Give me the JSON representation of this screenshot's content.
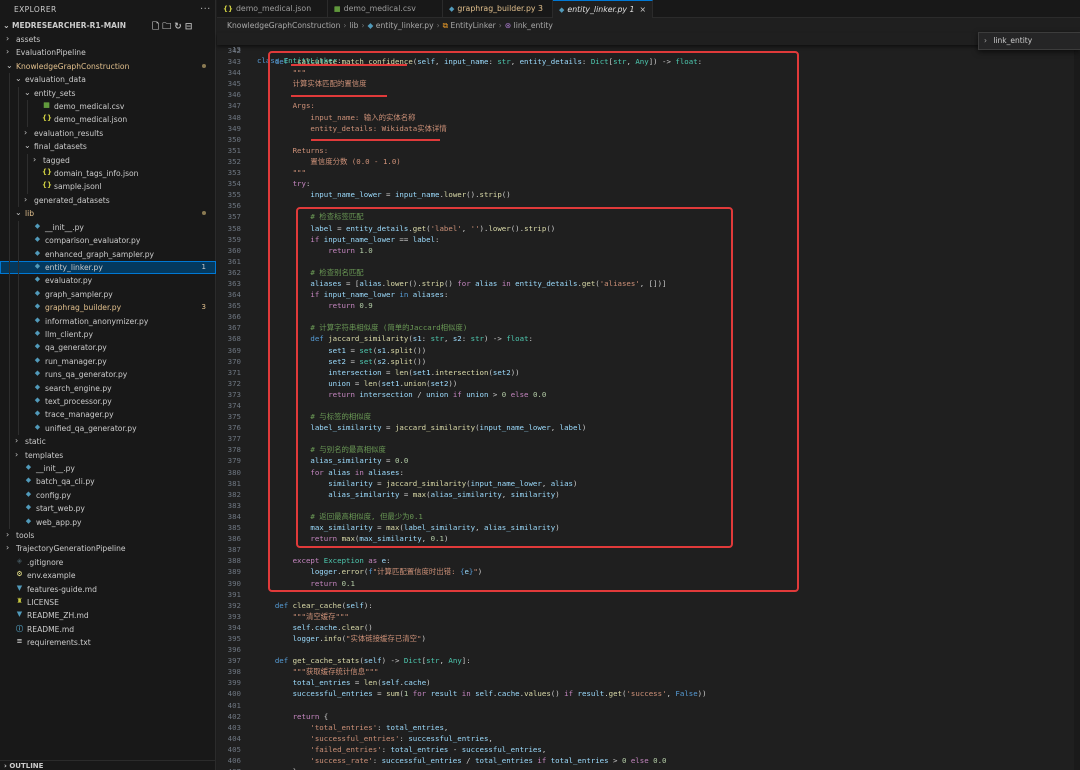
{
  "sidebar": {
    "title": "EXPLORER",
    "more": "···",
    "root_label": "MEDRESEARCHER-R1-MAIN",
    "tree": [
      {
        "depth": 0,
        "kind": "folder",
        "open": false,
        "label": "assets"
      },
      {
        "depth": 0,
        "kind": "folder",
        "open": false,
        "label": "EvaluationPipeline"
      },
      {
        "depth": 0,
        "kind": "folder",
        "open": true,
        "label": "KnowledgeGraphConstruction",
        "modified": true,
        "dot": true
      },
      {
        "depth": 1,
        "kind": "folder",
        "open": true,
        "label": "evaluation_data"
      },
      {
        "depth": 2,
        "kind": "folder",
        "open": true,
        "label": "entity_sets"
      },
      {
        "depth": 3,
        "kind": "csv",
        "label": "demo_medical.csv"
      },
      {
        "depth": 3,
        "kind": "json",
        "label": "demo_medical.json"
      },
      {
        "depth": 2,
        "kind": "folder",
        "open": false,
        "label": "evaluation_results"
      },
      {
        "depth": 2,
        "kind": "folder",
        "open": true,
        "label": "final_datasets"
      },
      {
        "depth": 3,
        "kind": "folder",
        "open": false,
        "label": "tagged"
      },
      {
        "depth": 3,
        "kind": "json",
        "label": "domain_tags_info.json"
      },
      {
        "depth": 3,
        "kind": "json",
        "label": "sample.jsonl"
      },
      {
        "depth": 2,
        "kind": "folder",
        "open": false,
        "label": "generated_datasets"
      },
      {
        "depth": 1,
        "kind": "folder",
        "open": true,
        "label": "lib",
        "modified": true,
        "dot": true
      },
      {
        "depth": 2,
        "kind": "py",
        "label": "__init__.py"
      },
      {
        "depth": 2,
        "kind": "py",
        "label": "comparison_evaluator.py"
      },
      {
        "depth": 2,
        "kind": "py",
        "label": "enhanced_graph_sampler.py"
      },
      {
        "depth": 2,
        "kind": "py",
        "label": "entity_linker.py",
        "active": true,
        "badge": "1"
      },
      {
        "depth": 2,
        "kind": "py",
        "label": "evaluator.py"
      },
      {
        "depth": 2,
        "kind": "py",
        "label": "graph_sampler.py"
      },
      {
        "depth": 2,
        "kind": "py",
        "label": "graphrag_builder.py",
        "modified": true,
        "badge": "3"
      },
      {
        "depth": 2,
        "kind": "py",
        "label": "information_anonymizer.py"
      },
      {
        "depth": 2,
        "kind": "py",
        "label": "llm_client.py"
      },
      {
        "depth": 2,
        "kind": "py",
        "label": "qa_generator.py"
      },
      {
        "depth": 2,
        "kind": "py",
        "label": "run_manager.py"
      },
      {
        "depth": 2,
        "kind": "py",
        "label": "runs_qa_generator.py"
      },
      {
        "depth": 2,
        "kind": "py",
        "label": "search_engine.py"
      },
      {
        "depth": 2,
        "kind": "py",
        "label": "text_processor.py"
      },
      {
        "depth": 2,
        "kind": "py",
        "label": "trace_manager.py"
      },
      {
        "depth": 2,
        "kind": "py",
        "label": "unified_qa_generator.py"
      },
      {
        "depth": 1,
        "kind": "folder",
        "open": false,
        "label": "static"
      },
      {
        "depth": 1,
        "kind": "folder",
        "open": false,
        "label": "templates"
      },
      {
        "depth": 1,
        "kind": "py",
        "label": "__init__.py"
      },
      {
        "depth": 1,
        "kind": "py",
        "label": "batch_qa_cli.py"
      },
      {
        "depth": 1,
        "kind": "py",
        "label": "config.py"
      },
      {
        "depth": 1,
        "kind": "py",
        "label": "start_web.py"
      },
      {
        "depth": 1,
        "kind": "py",
        "label": "web_app.py"
      },
      {
        "depth": 0,
        "kind": "folder",
        "open": false,
        "label": "tools"
      },
      {
        "depth": 0,
        "kind": "folder",
        "open": false,
        "label": "TrajectoryGenerationPipeline"
      },
      {
        "depth": 0,
        "kind": "git",
        "label": ".gitignore"
      },
      {
        "depth": 0,
        "kind": "env",
        "label": "env.example"
      },
      {
        "depth": 0,
        "kind": "md",
        "label": "features-guide.md"
      },
      {
        "depth": 0,
        "kind": "license",
        "label": "LICENSE"
      },
      {
        "depth": 0,
        "kind": "md",
        "label": "README_ZH.md"
      },
      {
        "depth": 0,
        "kind": "info",
        "label": "README.md"
      },
      {
        "depth": 0,
        "kind": "txt",
        "label": "requirements.txt"
      }
    ],
    "outline_label": "OUTLINE"
  },
  "tabs": [
    {
      "icon": "{}",
      "label": "demo_medical.json",
      "color": "#cbcb41"
    },
    {
      "icon": "▦",
      "label": "demo_medical.csv",
      "color": "#89e051"
    },
    {
      "icon": "◆",
      "label": "graphrag_builder.py 3",
      "color": "#519aba",
      "modified": true
    },
    {
      "icon": "◆",
      "label": "entity_linker.py 1",
      "color": "#519aba",
      "active": true,
      "close": "×"
    }
  ],
  "breadcrumb": [
    "KnowledgeGraphConstruction",
    "lib",
    "entity_linker.py",
    "EntityLinker",
    "link_entity"
  ],
  "find_widget": {
    "label": "link_entity"
  },
  "sticky": {
    "ln": "13",
    "code": "class EntityLinker:"
  },
  "code_lines": [
    {
      "n": "342",
      "h": ""
    },
    {
      "n": "343",
      "h": "    <span class='kw'>def</span> <span class='fn'>_calculate_match_confidence</span>(<span class='va'>self</span>, <span class='va'>input_name</span>: <span class='ty'>str</span>, <span class='va'>entity_details</span>: <span class='ty'>Dict</span>[<span class='ty'>str</span>, <span class='ty'>Any</span>]) -> <span class='ty'>float</span>:"
    },
    {
      "n": "344",
      "h": "        <span class='str'>\"\"\"</span>"
    },
    {
      "n": "345",
      "h": "        <span class='str'>计算实体匹配的置信度</span>"
    },
    {
      "n": "346",
      "h": ""
    },
    {
      "n": "347",
      "h": "        <span class='str'>Args:</span>"
    },
    {
      "n": "348",
      "h": "            <span class='str'>input_name: 输入的实体名称</span>"
    },
    {
      "n": "349",
      "h": "            <span class='str'>entity_details: Wikidata实体详情</span>"
    },
    {
      "n": "350",
      "h": ""
    },
    {
      "n": "351",
      "h": "        <span class='str'>Returns:</span>"
    },
    {
      "n": "352",
      "h": "            <span class='str'>置信度分数 (0.0 - 1.0)</span>"
    },
    {
      "n": "353",
      "h": "        <span class='str'>\"\"\"</span>"
    },
    {
      "n": "354",
      "h": "        <span class='kw2'>try</span>:"
    },
    {
      "n": "355",
      "h": "            <span class='va'>input_name_lower</span> = <span class='va'>input_name</span>.<span class='fn'>lower</span>().<span class='fn'>strip</span>()"
    },
    {
      "n": "356",
      "h": ""
    },
    {
      "n": "357",
      "h": "            <span class='cm'># 检查标签匹配</span>"
    },
    {
      "n": "358",
      "h": "            <span class='va'>label</span> = <span class='va'>entity_details</span>.<span class='fn'>get</span>(<span class='str'>'label'</span>, <span class='str'>''</span>).<span class='fn'>lower</span>().<span class='fn'>strip</span>()"
    },
    {
      "n": "359",
      "h": "            <span class='kw2'>if</span> <span class='va'>input_name_lower</span> == <span class='va'>label</span>:"
    },
    {
      "n": "360",
      "h": "                <span class='kw2'>return</span> <span class='num'>1.0</span>"
    },
    {
      "n": "361",
      "h": ""
    },
    {
      "n": "362",
      "h": "            <span class='cm'># 检查别名匹配</span>"
    },
    {
      "n": "363",
      "h": "            <span class='va'>aliases</span> = [<span class='va'>alias</span>.<span class='fn'>lower</span>().<span class='fn'>strip</span>() <span class='kw2'>for</span> <span class='va'>alias</span> <span class='kw2'>in</span> <span class='va'>entity_details</span>.<span class='fn'>get</span>(<span class='str'>'aliases'</span>, [])]"
    },
    {
      "n": "364",
      "h": "            <span class='kw2'>if</span> <span class='va'>input_name_lower</span> <span class='kw'>in</span> <span class='va'>aliases</span>:"
    },
    {
      "n": "365",
      "h": "                <span class='kw2'>return</span> <span class='num'>0.9</span>"
    },
    {
      "n": "366",
      "h": ""
    },
    {
      "n": "367",
      "h": "            <span class='cm'># 计算字符串相似度 (简单的Jaccard相似度)</span>"
    },
    {
      "n": "368",
      "h": "            <span class='kw'>def</span> <span class='fn'>jaccard_similarity</span>(<span class='va'>s1</span>: <span class='ty'>str</span>, <span class='va'>s2</span>: <span class='ty'>str</span>) -> <span class='ty'>float</span>:"
    },
    {
      "n": "369",
      "h": "                <span class='va'>set1</span> = <span class='ty'>set</span>(<span class='va'>s1</span>.<span class='fn'>split</span>())"
    },
    {
      "n": "370",
      "h": "                <span class='va'>set2</span> = <span class='ty'>set</span>(<span class='va'>s2</span>.<span class='fn'>split</span>())"
    },
    {
      "n": "371",
      "h": "                <span class='va'>intersection</span> = <span class='fn'>len</span>(<span class='va'>set1</span>.<span class='fn'>intersection</span>(<span class='va'>set2</span>))"
    },
    {
      "n": "372",
      "h": "                <span class='va'>union</span> = <span class='fn'>len</span>(<span class='va'>set1</span>.<span class='fn'>union</span>(<span class='va'>set2</span>))"
    },
    {
      "n": "373",
      "h": "                <span class='kw2'>return</span> <span class='va'>intersection</span> / <span class='va'>union</span> <span class='kw2'>if</span> <span class='va'>union</span> > <span class='num'>0</span> <span class='kw2'>else</span> <span class='num'>0.0</span>"
    },
    {
      "n": "374",
      "h": ""
    },
    {
      "n": "375",
      "h": "            <span class='cm'># 与标签的相似度</span>"
    },
    {
      "n": "376",
      "h": "            <span class='va'>label_similarity</span> = <span class='fn'>jaccard_similarity</span>(<span class='va'>input_name_lower</span>, <span class='va'>label</span>)"
    },
    {
      "n": "377",
      "h": ""
    },
    {
      "n": "378",
      "h": "            <span class='cm'># 与别名的最高相似度</span>"
    },
    {
      "n": "379",
      "h": "            <span class='va'>alias_similarity</span> = <span class='num'>0.0</span>"
    },
    {
      "n": "380",
      "h": "            <span class='kw2'>for</span> <span class='va'>alias</span> <span class='kw2'>in</span> <span class='va'>aliases</span>:"
    },
    {
      "n": "381",
      "h": "                <span class='va'>similarity</span> = <span class='fn'>jaccard_similarity</span>(<span class='va'>input_name_lower</span>, <span class='va'>alias</span>)"
    },
    {
      "n": "382",
      "h": "                <span class='va'>alias_similarity</span> = <span class='fn'>max</span>(<span class='va'>alias_similarity</span>, <span class='va'>similarity</span>)"
    },
    {
      "n": "383",
      "h": ""
    },
    {
      "n": "384",
      "h": "            <span class='cm'># 返回最高相似度, 但最少为0.1</span>"
    },
    {
      "n": "385",
      "h": "            <span class='va'>max_similarity</span> = <span class='fn'>max</span>(<span class='va'>label_similarity</span>, <span class='va'>alias_similarity</span>)"
    },
    {
      "n": "386",
      "h": "            <span class='kw2'>return</span> <span class='fn'>max</span>(<span class='va'>max_similarity</span>, <span class='num'>0.1</span>)"
    },
    {
      "n": "387",
      "h": ""
    },
    {
      "n": "388",
      "h": "        <span class='kw2'>except</span> <span class='ty'>Exception</span> <span class='kw2'>as</span> <span class='va'>e</span>:"
    },
    {
      "n": "389",
      "h": "            <span class='va'>logger</span>.<span class='fn'>error</span>(<span class='kw'>f</span><span class='str'>\"计算匹配置信度时出错: </span><span class='kw'>{</span><span class='va'>e</span><span class='kw'>}</span><span class='str'>\"</span>)"
    },
    {
      "n": "390",
      "h": "            <span class='kw2'>return</span> <span class='num'>0.1</span>"
    },
    {
      "n": "391",
      "h": ""
    },
    {
      "n": "392",
      "h": "    <span class='kw'>def</span> <span class='fn'>clear_cache</span>(<span class='va'>self</span>):"
    },
    {
      "n": "393",
      "h": "        <span class='str'>\"\"\"清空缓存\"\"\"</span>"
    },
    {
      "n": "394",
      "h": "        <span class='va'>self</span>.<span class='va'>cache</span>.<span class='fn'>clear</span>()"
    },
    {
      "n": "395",
      "h": "        <span class='va'>logger</span>.<span class='fn'>info</span>(<span class='str'>\"实体链接缓存已清空\"</span>)"
    },
    {
      "n": "396",
      "h": ""
    },
    {
      "n": "397",
      "h": "    <span class='kw'>def</span> <span class='fn'>get_cache_stats</span>(<span class='va'>self</span>) -> <span class='ty'>Dict</span>[<span class='ty'>str</span>, <span class='ty'>Any</span>]:"
    },
    {
      "n": "398",
      "h": "        <span class='str'>\"\"\"获取缓存统计信息\"\"\"</span>"
    },
    {
      "n": "399",
      "h": "        <span class='va'>total_entries</span> = <span class='fn'>len</span>(<span class='va'>self</span>.<span class='va'>cache</span>)"
    },
    {
      "n": "400",
      "h": "        <span class='va'>successful_entries</span> = <span class='fn'>sum</span>(<span class='num'>1</span> <span class='kw2'>for</span> <span class='va'>result</span> <span class='kw2'>in</span> <span class='va'>self</span>.<span class='va'>cache</span>.<span class='fn'>values</span>() <span class='kw2'>if</span> <span class='va'>result</span>.<span class='fn'>get</span>(<span class='str'>'success'</span>, <span class='kw'>False</span>))"
    },
    {
      "n": "401",
      "h": ""
    },
    {
      "n": "402",
      "h": "        <span class='kw2'>return</span> {"
    },
    {
      "n": "403",
      "h": "            <span class='str'>'total_entries'</span>: <span class='va'>total_entries</span>,"
    },
    {
      "n": "404",
      "h": "            <span class='str'>'successful_entries'</span>: <span class='va'>successful_entries</span>,"
    },
    {
      "n": "405",
      "h": "            <span class='str'>'failed_entries'</span>: <span class='va'>total_entries</span> - <span class='va'>successful_entries</span>,"
    },
    {
      "n": "406",
      "h": "            <span class='str'>'success_rate'</span>: <span class='va'>successful_entries</span> / <span class='va'>total_entries</span> <span class='kw2'>if</span> <span class='va'>total_entries</span> > <span class='num'>0</span> <span class='kw2'>else</span> <span class='num'>0.0</span>"
    },
    {
      "n": "407",
      "h": "        }"
    }
  ],
  "colors": {
    "annotation": "#e03a3a",
    "active_row": "#04395e",
    "accent": "#0078d4",
    "modified": "#e2c08d"
  }
}
